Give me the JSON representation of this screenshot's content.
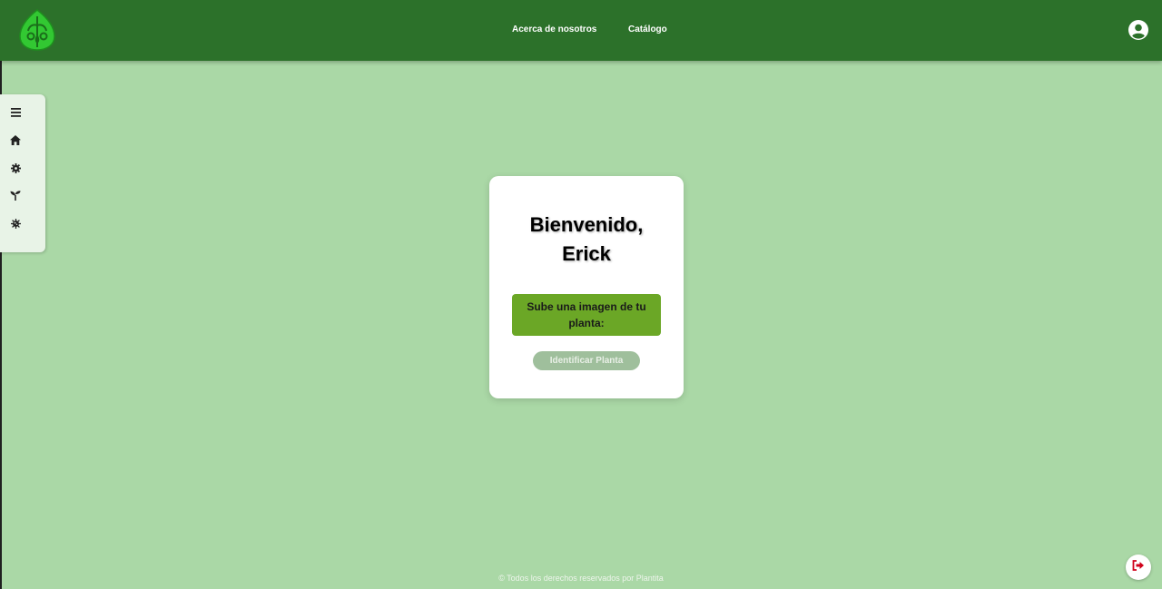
{
  "header": {
    "logo_icon": "leaf-logo-icon",
    "nav": {
      "about_label": "Acerca de nosotros",
      "catalog_label": "Catálogo"
    },
    "user_icon": "user-circle-icon"
  },
  "sidebar": {
    "items": [
      {
        "icon": "menu-icon"
      },
      {
        "icon": "home-icon"
      },
      {
        "icon": "gear-icon"
      },
      {
        "icon": "seedling-icon"
      },
      {
        "icon": "virus-icon"
      }
    ]
  },
  "main": {
    "welcome_line1": "Bienvenido,",
    "welcome_line2": "Erick",
    "upload_label": "Sube una imagen de tu planta:",
    "identify_label": "Identificar Planta"
  },
  "footer": {
    "text": "© Todos los derechos reservados por Plantita"
  },
  "logout": {
    "icon": "logout-icon"
  },
  "colors": {
    "header_bg": "#2c712a",
    "page_bg": "#aad8a6",
    "upload_bg": "#6ba726",
    "identify_bg": "#9fbf9c",
    "logout_icon": "#d0021b"
  }
}
